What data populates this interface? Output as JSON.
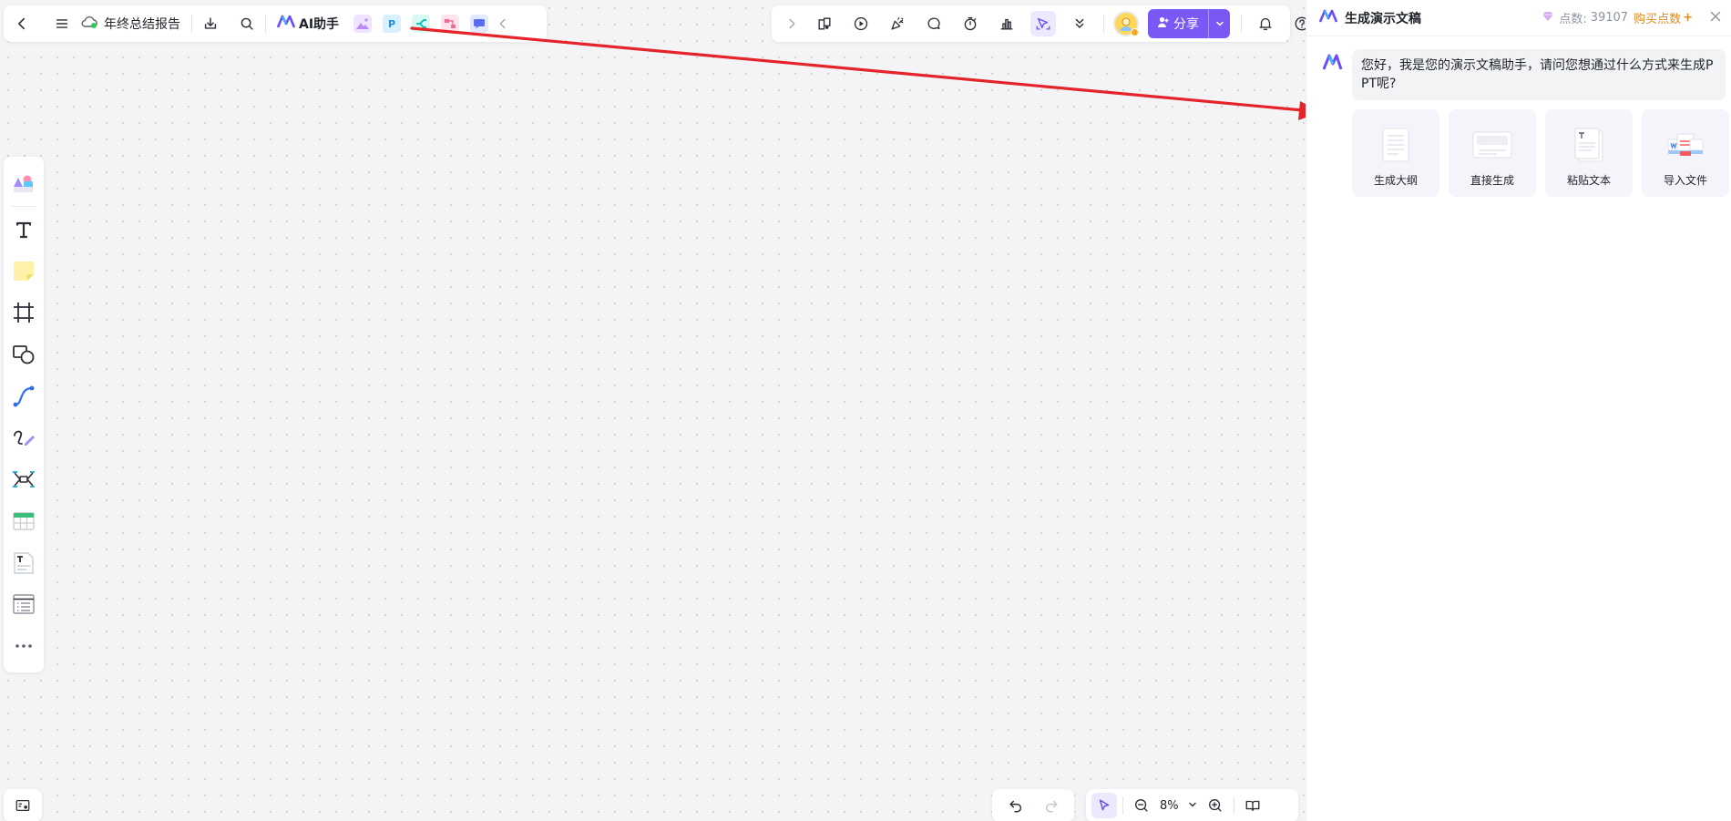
{
  "doc": {
    "title": "年终总结报告",
    "ai_label": "AI助手"
  },
  "topbar_right": {
    "share_label": "分享"
  },
  "zoom": {
    "level": "8%"
  },
  "panel": {
    "title": "生成演示文稿",
    "points_label": "点数:",
    "points_value": "39107",
    "buy_label": "购买点数",
    "buy_plus": "+",
    "greeting": "您好，我是您的演示文稿助手，请问您想通过什么方式来生成PPT呢?",
    "options": [
      {
        "label": "生成大纲",
        "icon": "outline-doc-icon"
      },
      {
        "label": "直接生成",
        "icon": "slide-generate-icon"
      },
      {
        "label": "粘贴文本",
        "icon": "paste-text-icon"
      },
      {
        "label": "导入文件",
        "icon": "import-file-icon"
      }
    ]
  },
  "colors": {
    "accent": "#7a58f6",
    "arrow": "#e5232b",
    "buy": "#e08a1e",
    "canvas": "#f4f4f6"
  }
}
